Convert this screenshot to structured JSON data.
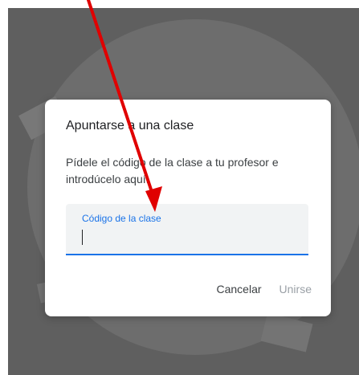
{
  "dialog": {
    "title": "Apuntarse a una clase",
    "body": "Pídele el código de la clase a tu profesor e introdúcelo aquí.",
    "field": {
      "label": "Código de la clase",
      "value": ""
    },
    "buttons": {
      "cancel": "Cancelar",
      "join": "Unirse"
    }
  },
  "colors": {
    "accent": "#1a73e8",
    "annotation": "#e00000",
    "backdrop": "#5f5f5f",
    "disabled_text": "#9aa0a6"
  }
}
